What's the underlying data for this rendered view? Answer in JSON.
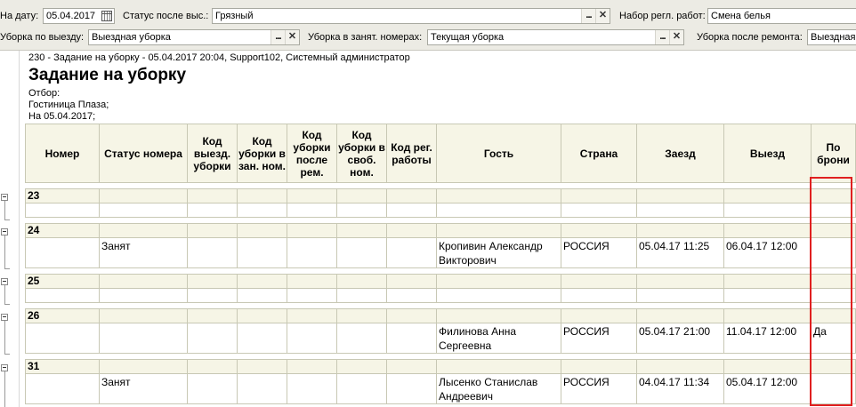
{
  "filters": {
    "date_label": "На дату:",
    "date_value": "05.04.2017",
    "status_label": "Статус после выс.:",
    "status_value": "Грязный",
    "reg_label": "Набор регл. работ:",
    "reg_value": "Смена белья",
    "checkout_label": "Уборка по выезду:",
    "checkout_value": "Выездная уборка",
    "occupied_label": "Уборка в занят. номерах:",
    "occupied_value": "Текущая уборка",
    "repair_label": "Уборка после ремонта:",
    "repair_value": "Выездная",
    "dots": "...",
    "clear": "✕"
  },
  "report": {
    "line1": "230 - Задание на уборку - 05.04.2017 20:04, Support102, Системный администратор",
    "title": "Задание на уборку",
    "filter_label": "Отбор:",
    "hotel": "Гостиница Плаза;",
    "on_date": "На 05.04.2017;"
  },
  "columns": [
    "Номер",
    "Статус номера",
    "Код выезд. уборки",
    "Код уборки в зан. ном.",
    "Код уборки после рем.",
    "Код уборки в своб. ном.",
    "Код рег. работы",
    "Гость",
    "Страна",
    "Заезд",
    "Выезд",
    "По брони"
  ],
  "groups": [
    {
      "number": "23",
      "row": {
        "status": "",
        "guest": "",
        "country": "",
        "checkin": "",
        "checkout": "",
        "booking": ""
      }
    },
    {
      "number": "24",
      "row": {
        "status": "Занят",
        "guest": "Кропивин Александр Викторович",
        "country": "РОССИЯ",
        "checkin": "05.04.17 11:25",
        "checkout": "06.04.17 12:00",
        "booking": ""
      }
    },
    {
      "number": "25",
      "row": {
        "status": "",
        "guest": "",
        "country": "",
        "checkin": "",
        "checkout": "",
        "booking": ""
      }
    },
    {
      "number": "26",
      "row": {
        "status": "",
        "guest": "Филинова Анна Сергеевна",
        "country": "РОССИЯ",
        "checkin": "05.04.17 21:00",
        "checkout": "11.04.17 12:00",
        "booking": "Да"
      }
    },
    {
      "number": "31",
      "row": {
        "status": "Занят",
        "guest": "Лысенко Станислав Андреевич",
        "country": "РОССИЯ",
        "checkin": "04.04.17 11:34",
        "checkout": "05.04.17 12:00",
        "booking": ""
      }
    }
  ]
}
